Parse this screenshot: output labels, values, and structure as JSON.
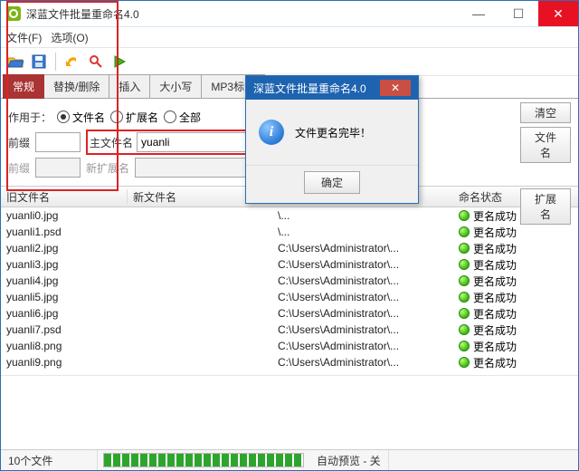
{
  "window": {
    "title": "深蓝文件批量重命名4.0"
  },
  "menu": {
    "file": "文件(F)",
    "options": "选项(O)"
  },
  "toolbar_icons": {
    "open": "folder-open-icon",
    "save": "save-icon",
    "undo": "undo-icon",
    "search": "search-icon",
    "run": "run-icon"
  },
  "tabs": {
    "general": "常规",
    "replace": "替换/删除",
    "insert": "插入",
    "case": "大小写",
    "mp3": "MP3标签"
  },
  "panel": {
    "apply_to": "作用于：",
    "opt_filename": "文件名",
    "opt_ext": "扩展名",
    "opt_all": "全部",
    "prefix": "前缀",
    "main_name": "主文件名",
    "main_value": "yuanli",
    "prefix2": "前缀",
    "new_ext": "新扩展名"
  },
  "sidebtns": {
    "clear": "清空",
    "filename": "文件名",
    "ext": "扩展名"
  },
  "columns": {
    "old": "旧文件名",
    "new": "新文件名",
    "stat": "命名状态",
    "mp3": "MP3标"
  },
  "rows": [
    {
      "old": "yuanli0.jpg",
      "path": "\\...",
      "stat": "更名成功"
    },
    {
      "old": "yuanli1.psd",
      "path": "\\...",
      "stat": "更名成功"
    },
    {
      "old": "yuanli2.jpg",
      "path": "C:\\Users\\Administrator\\...",
      "stat": "更名成功"
    },
    {
      "old": "yuanli3.jpg",
      "path": "C:\\Users\\Administrator\\...",
      "stat": "更名成功"
    },
    {
      "old": "yuanli4.jpg",
      "path": "C:\\Users\\Administrator\\...",
      "stat": "更名成功"
    },
    {
      "old": "yuanli5.jpg",
      "path": "C:\\Users\\Administrator\\...",
      "stat": "更名成功"
    },
    {
      "old": "yuanli6.jpg",
      "path": "C:\\Users\\Administrator\\...",
      "stat": "更名成功"
    },
    {
      "old": "yuanli7.psd",
      "path": "C:\\Users\\Administrator\\...",
      "stat": "更名成功"
    },
    {
      "old": "yuanli8.png",
      "path": "C:\\Users\\Administrator\\...",
      "stat": "更名成功"
    },
    {
      "old": "yuanli9.png",
      "path": "C:\\Users\\Administrator\\...",
      "stat": "更名成功"
    }
  ],
  "status": {
    "count": "10个文件",
    "preview": "自动预览 - 关"
  },
  "dialog": {
    "title": "深蓝文件批量重命名4.0",
    "message": "文件更名完毕！",
    "ok": "确定"
  }
}
